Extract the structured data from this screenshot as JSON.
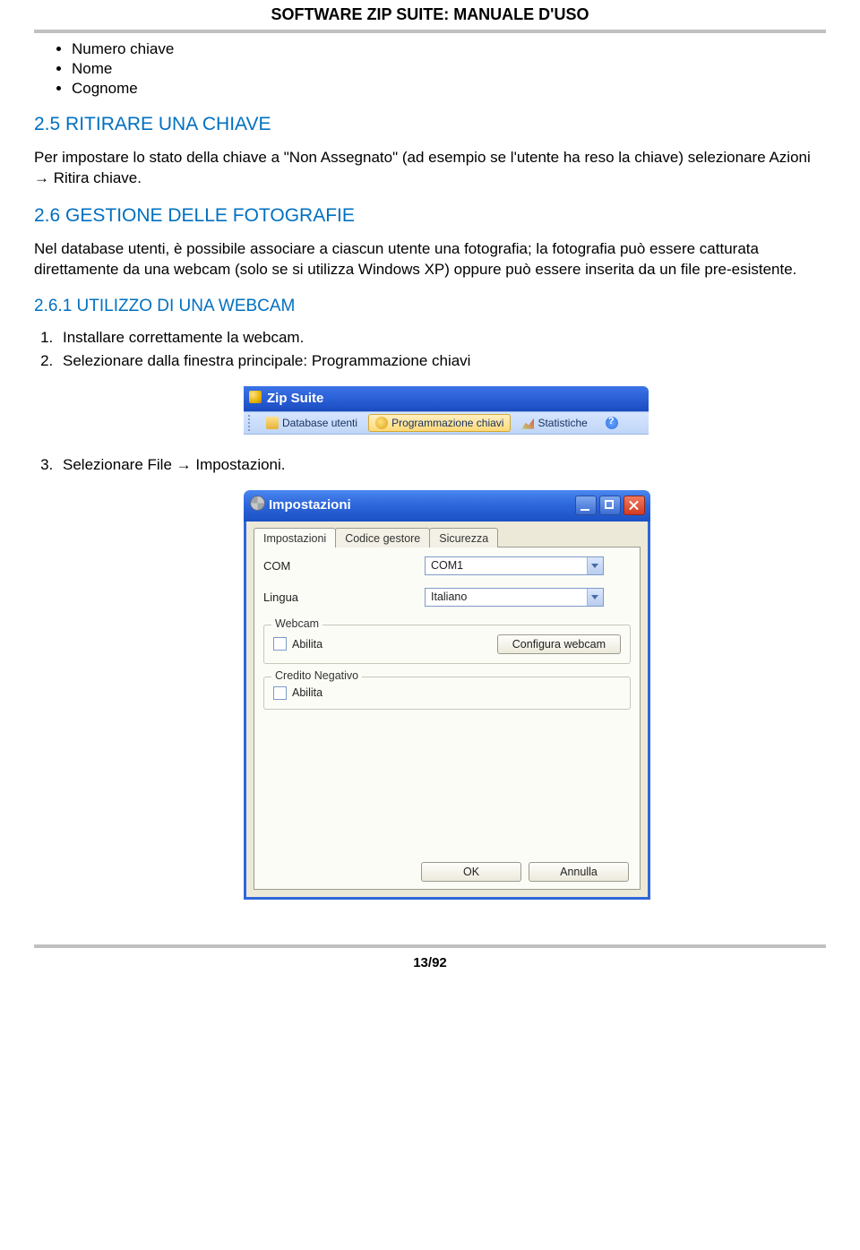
{
  "doc_header": "SOFTWARE ZIP SUITE: MANUALE D'USO",
  "bullets": [
    "Numero chiave",
    "Nome",
    "Cognome"
  ],
  "sec25": {
    "heading": "2.5 RITIRARE UNA CHIAVE",
    "para": "Per impostare lo stato della chiave a \"Non Assegnato\" (ad esempio se l'utente ha reso la chiave) selezionare Azioni → Ritira chiave."
  },
  "sec26": {
    "heading": "2.6 GESTIONE DELLE FOTOGRAFIE",
    "para": "Nel database utenti, è possibile associare a ciascun utente una fotografia; la fotografia può essere catturata direttamente da una webcam (solo se si utilizza Windows XP) oppure può essere inserita da un file pre-esistente."
  },
  "sec261": {
    "heading": "2.6.1 UTILIZZO DI UNA WEBCAM",
    "step1": "Installare correttamente la webcam.",
    "step2": "Selezionare dalla finestra principale: Programmazione chiavi",
    "step3": "Selezionare File → Impostazioni."
  },
  "toolbar_shot": {
    "title": "Zip Suite",
    "btn_db": "Database utenti",
    "btn_prog": "Programmazione chiavi",
    "btn_stats": "Statistiche"
  },
  "settings_dialog": {
    "title": "Impostazioni",
    "tabs": [
      "Impostazioni",
      "Codice gestore",
      "Sicurezza"
    ],
    "com": {
      "label": "COM",
      "value": "COM1"
    },
    "lang": {
      "label": "Lingua",
      "value": "Italiano"
    },
    "grp_webcam": {
      "legend": "Webcam",
      "abilita": "Abilita",
      "config": "Configura webcam"
    },
    "grp_credito": {
      "legend": "Credito Negativo",
      "abilita": "Abilita"
    },
    "ok": "OK",
    "cancel": "Annulla"
  },
  "page_number": "13/92"
}
